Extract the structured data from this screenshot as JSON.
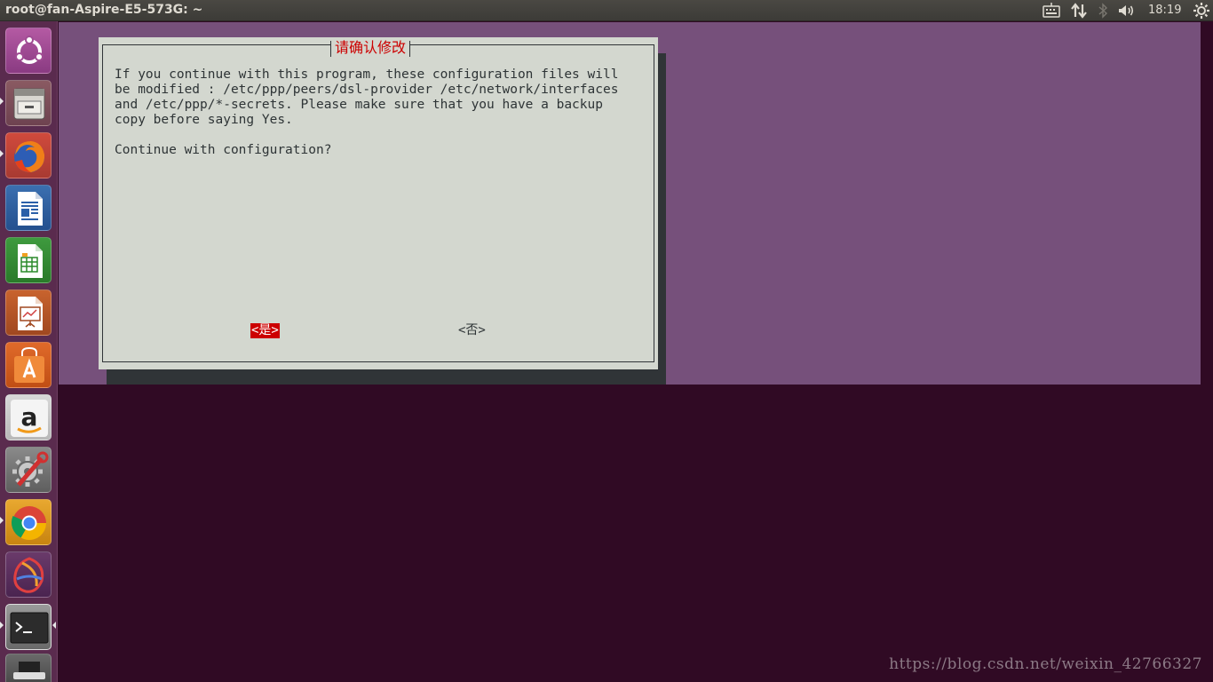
{
  "top_panel": {
    "window_title": "root@fan-Aspire-E5-573G: ~",
    "clock": "18:19",
    "icons": [
      "keyboard-icon",
      "network-icon",
      "bluetooth-icon",
      "volume-icon",
      "gear-icon"
    ]
  },
  "launcher": {
    "items": [
      {
        "name": "Dash Home",
        "icon": "ubuntu-logo-icon"
      },
      {
        "name": "Files",
        "icon": "file-cabinet-icon"
      },
      {
        "name": "Firefox Web Browser",
        "icon": "firefox-icon"
      },
      {
        "name": "LibreOffice Writer",
        "icon": "writer-icon"
      },
      {
        "name": "LibreOffice Calc",
        "icon": "calc-icon"
      },
      {
        "name": "LibreOffice Impress",
        "icon": "impress-icon"
      },
      {
        "name": "Ubuntu Software",
        "icon": "software-center-icon"
      },
      {
        "name": "Amazon",
        "icon": "amazon-icon"
      },
      {
        "name": "System Settings",
        "icon": "settings-icon"
      },
      {
        "name": "Google Chrome",
        "icon": "chrome-icon"
      },
      {
        "name": "NetBeans",
        "icon": "netbeans-icon"
      },
      {
        "name": "Terminal",
        "icon": "terminal-icon"
      },
      {
        "name": "USB Drive",
        "icon": "usb-drive-icon"
      }
    ]
  },
  "dialog": {
    "title": "请确认修改",
    "message_lines": [
      "If you continue with this program, these configuration files will",
      "be modified : /etc/ppp/peers/dsl-provider /etc/network/interfaces",
      "and /etc/ppp/*-secrets. Please make sure that you have a backup",
      "copy before saying Yes.",
      "",
      "Continue with configuration?"
    ],
    "yes_button": "<是>",
    "no_button": "<否>"
  },
  "watermark": "https://blog.csdn.net/weixin_42766327",
  "colors": {
    "desktop": "#300a24",
    "dialog_backdrop": "#76507b",
    "dialog_bg": "#d3d7cf",
    "accent_red": "#cc0000",
    "launcher_bg": "#5a2b4e"
  }
}
